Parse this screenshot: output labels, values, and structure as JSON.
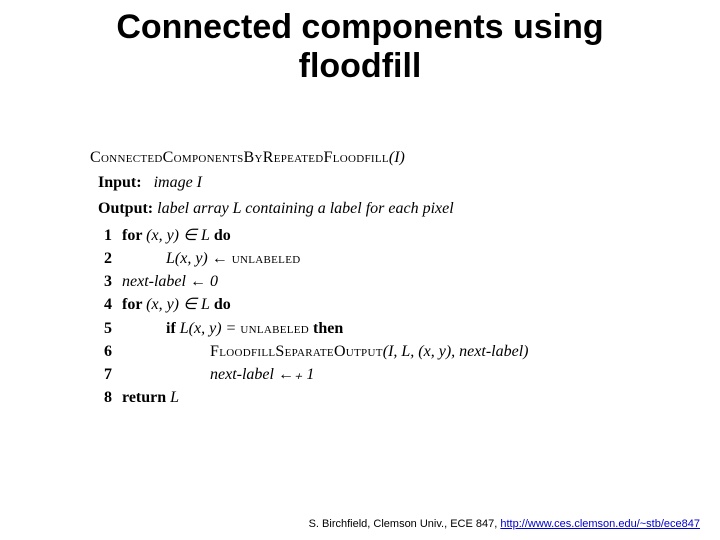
{
  "title_line1": "Connected components using",
  "title_line2": "floodfill",
  "algo": {
    "header_pre": "ConnectedComponentsByRepeatedFloodfill",
    "header_arg": "(I)",
    "input_label": "Input:",
    "input_text": "image I",
    "output_label": "Output:",
    "output_text": "label array L containing a label for each pixel",
    "lines": {
      "1": {
        "pre": "for ",
        "math": "(x, y) ∈ L",
        "post": " do"
      },
      "2": {
        "math": "L(x, y) ← ",
        "sc": "unlabeled"
      },
      "3": {
        "math": "next-label ← 0"
      },
      "4": {
        "pre": "for ",
        "math": "(x, y) ∈ L",
        "post": " do"
      },
      "5": {
        "pre": "if ",
        "math": "L(x, y) = ",
        "sc": "unlabeled",
        "post": " then"
      },
      "6": {
        "sc": "FloodfillSeparateOutput",
        "math": "(I, L, (x, y), next-label)"
      },
      "7": {
        "math": "next-label ←₊ 1"
      },
      "8": {
        "pre": "return ",
        "math": "L"
      }
    }
  },
  "footer": {
    "prefix": "S. Birchfield, Clemson Univ., ECE 847, ",
    "link": "http://www.ces.clemson.edu/~stb/ece847"
  }
}
